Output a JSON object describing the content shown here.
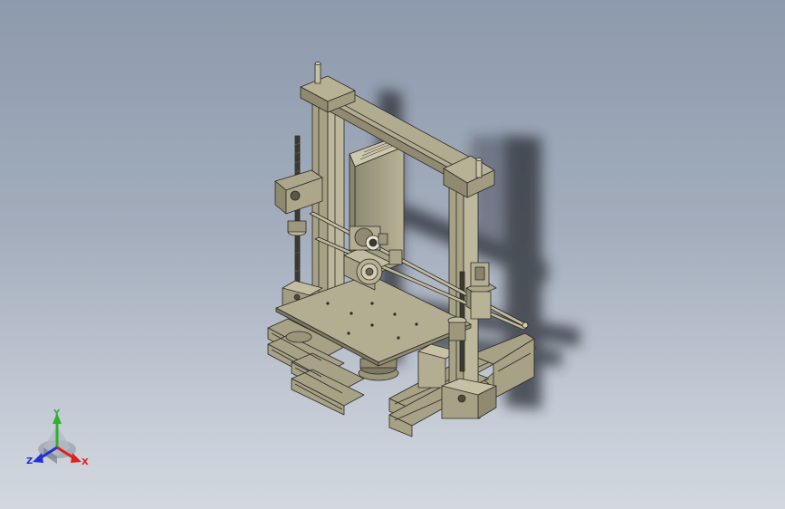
{
  "viewport": {
    "background_top": "#8d9aad",
    "background_bottom": "#d3d8df",
    "model_color": "#a7a186",
    "edge_color": "#2a2a24"
  },
  "triad": {
    "x_label": "X",
    "y_label": "Y",
    "z_label": "Z",
    "x_color": "#e0201b",
    "y_color": "#2fb12f",
    "z_color": "#2030e0"
  }
}
